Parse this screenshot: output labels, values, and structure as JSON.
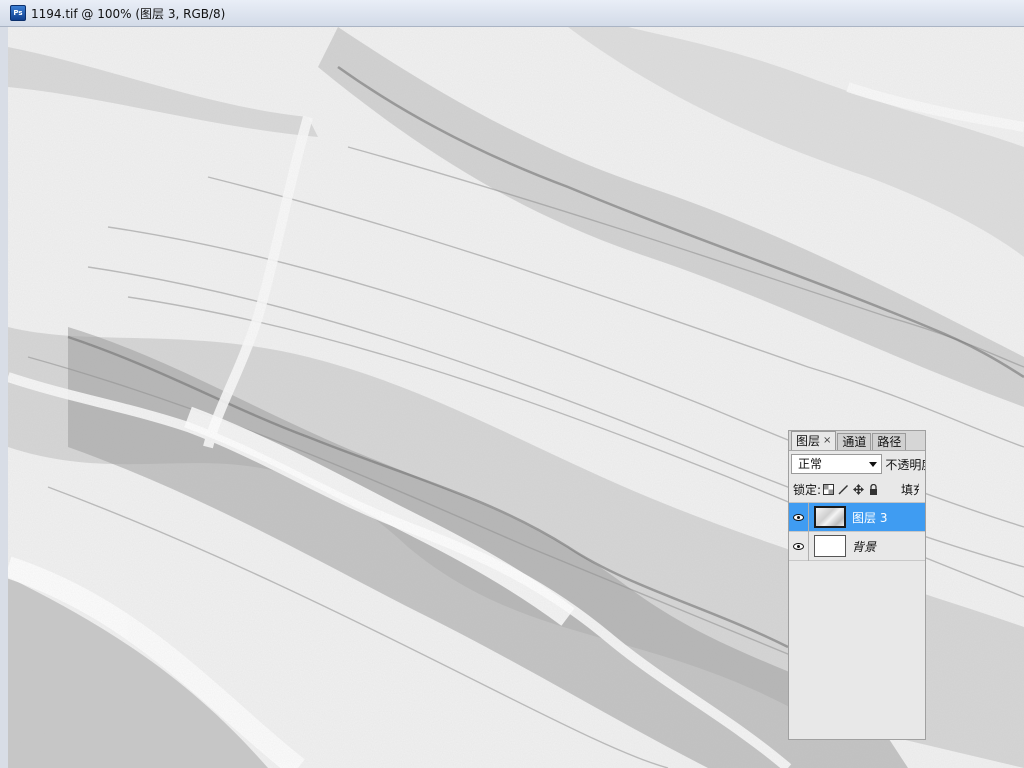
{
  "window": {
    "app_icon": "photoshop-icon",
    "app_icon_text": "Ps",
    "title": "1194.tif @ 100% (图层 3, RGB/8)"
  },
  "layers_panel": {
    "tabs": [
      {
        "label": "图层",
        "active": true,
        "close": "×"
      },
      {
        "label": "通道",
        "active": false
      },
      {
        "label": "路径",
        "active": false
      }
    ],
    "blend_mode": "正常",
    "opacity_label": "不透明度",
    "lock_label": "锁定:",
    "lock_icons": [
      "lock-transparent-icon",
      "lock-paint-icon",
      "lock-move-icon",
      "lock-all-icon"
    ],
    "fill_label": "填充",
    "layers": [
      {
        "name": "图层 3",
        "selected": true,
        "visible": true,
        "thumb": "marble"
      },
      {
        "name": "背景",
        "selected": false,
        "visible": true,
        "thumb": "white"
      }
    ],
    "selection_color": "#3f9cf2"
  }
}
